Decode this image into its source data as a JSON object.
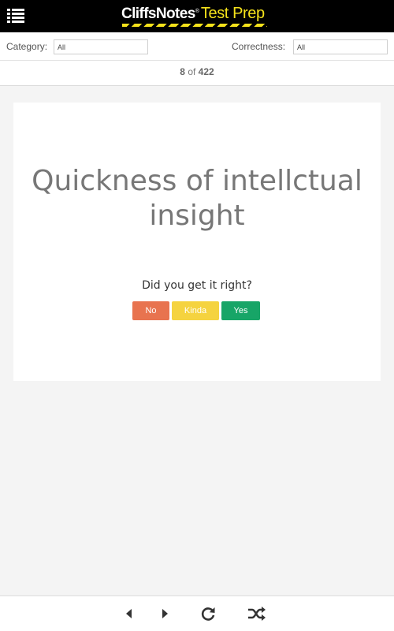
{
  "header": {
    "menu_icon": "list-menu-icon",
    "brand_primary": "CliffsNotes",
    "brand_mark": "®",
    "brand_secondary": "Test Prep",
    "colors": {
      "bar": "#000000",
      "accent": "#f5e21b"
    }
  },
  "filters": {
    "category_label": "Category:",
    "category_value": "All",
    "correctness_label": "Correctness:",
    "correctness_value": "All"
  },
  "counter": {
    "current": "8",
    "separator": "of",
    "total": "422"
  },
  "card": {
    "term": "Quickness of intellctual insight",
    "prompt": "Did you get it right?",
    "buttons": {
      "no": "No",
      "kinda": "Kinda",
      "yes": "Yes"
    },
    "colors": {
      "no": "#e8734f",
      "kinda": "#f5d33f",
      "yes": "#17a567"
    }
  },
  "bottom_nav": {
    "icons": [
      "previous-triangle-icon",
      "next-triangle-icon",
      "refresh-icon",
      "shuffle-icon"
    ]
  }
}
